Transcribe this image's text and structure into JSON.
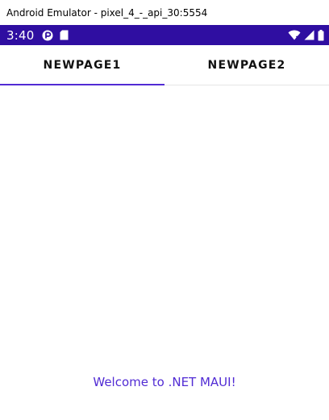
{
  "window": {
    "title": "Android Emulator - pixel_4_-_api_30:5554"
  },
  "status_bar": {
    "time": "3:40",
    "background_color": "#2f0ea1",
    "left_icons": [
      "play-protect-icon",
      "sd-card-icon"
    ],
    "right_icons": [
      "wifi-icon",
      "signal-icon",
      "battery-icon"
    ]
  },
  "tabs": [
    {
      "label": "NEWPAGE1",
      "selected": true
    },
    {
      "label": "NEWPAGE2",
      "selected": false
    }
  ],
  "accent_color": "#512bd4",
  "main": {
    "welcome_text": "Welcome to .NET MAUI!"
  }
}
